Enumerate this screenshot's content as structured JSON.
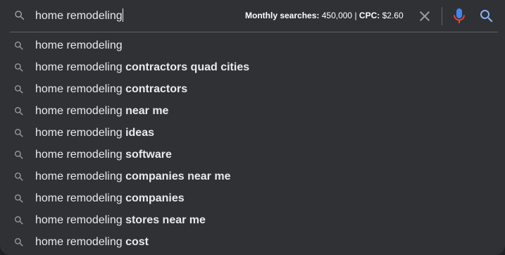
{
  "search": {
    "query": "home remodeling",
    "keyword_info": {
      "searches_label": "Monthly searches:",
      "searches_value": "450,000",
      "separator": "|",
      "cpc_label": "CPC:",
      "cpc_value": "$2.60"
    }
  },
  "icons": {
    "search": "search-icon",
    "clear": "close-icon",
    "mic": "microphone-icon",
    "submit": "search-icon"
  },
  "colors": {
    "background": "#303134",
    "text": "#e8eaed",
    "divider": "#5f6368",
    "mic_blue": "#4285f4",
    "mic_red": "#ea4335",
    "search_blue": "#8ab4f8"
  },
  "suggestions": [
    {
      "prefix": "home remodeling",
      "suffix": ""
    },
    {
      "prefix": "home remodeling ",
      "suffix": "contractors quad cities"
    },
    {
      "prefix": "home remodeling ",
      "suffix": "contractors"
    },
    {
      "prefix": "home remodeling ",
      "suffix": "near me"
    },
    {
      "prefix": "home remodeling ",
      "suffix": "ideas"
    },
    {
      "prefix": "home remodeling ",
      "suffix": "software"
    },
    {
      "prefix": "home remodeling ",
      "suffix": "companies near me"
    },
    {
      "prefix": "home remodeling ",
      "suffix": "companies"
    },
    {
      "prefix": "home remodeling ",
      "suffix": "stores near me"
    },
    {
      "prefix": "home remodeling ",
      "suffix": "cost"
    }
  ]
}
